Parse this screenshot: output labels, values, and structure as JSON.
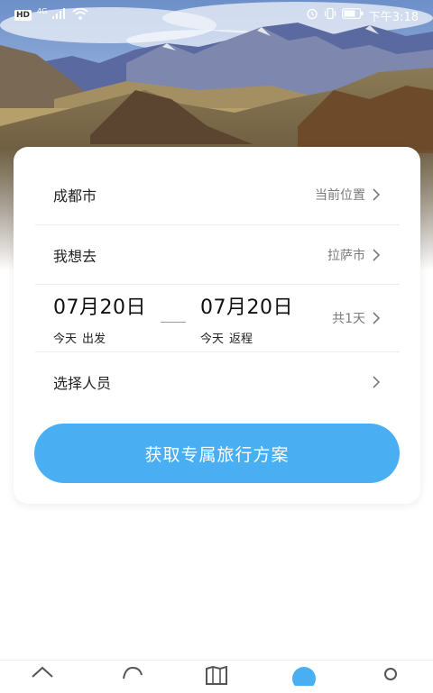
{
  "status_bar": {
    "hd_label": "HD",
    "network_label": "4G",
    "time": "下午3:18",
    "icons": [
      "alarm-icon",
      "vibrate-icon",
      "battery-icon",
      "signal-icon",
      "wifi-icon"
    ],
    "text_color": "#ffffff"
  },
  "trip_form": {
    "origin": {
      "label": "成都市",
      "action": "当前位置"
    },
    "destination": {
      "label": "我想去",
      "value": "拉萨市"
    },
    "dates": {
      "depart_date": "07月20日",
      "depart_day": "今天",
      "depart_label": "出发",
      "return_date": "07月20日",
      "return_day": "今天",
      "return_label": "返程",
      "duration": "共1天"
    },
    "travelers": {
      "label": "选择人员"
    },
    "submit_label": "获取专属旅行方案"
  },
  "tab_bar": {
    "tabs": [
      {
        "icon": "home-icon"
      },
      {
        "icon": "chat-icon"
      },
      {
        "icon": "map-icon"
      },
      {
        "icon": "compass-icon",
        "active": true
      },
      {
        "icon": "profile-icon"
      }
    ]
  },
  "colors": {
    "accent": "#4aaef2",
    "text_primary": "#222222",
    "text_secondary": "#7a7a7a",
    "divider": "#ececec"
  }
}
